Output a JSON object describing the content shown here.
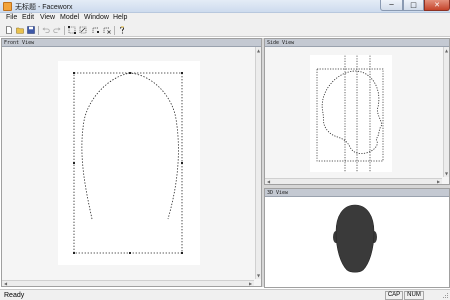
{
  "window": {
    "title": "无标题 - Faceworx",
    "minimize_glyph": "─",
    "maximize_glyph": "□",
    "close_glyph": "✕"
  },
  "menu": [
    "File",
    "Edit",
    "View",
    "Model",
    "Window",
    "Help"
  ],
  "toolbar": {
    "icons": [
      "new-file-icon",
      "open-folder-icon",
      "save-icon",
      "undo-icon",
      "redo-icon",
      "move-points-icon",
      "rotate-points-icon",
      "add-point-icon",
      "delete-point-icon",
      "help-icon"
    ]
  },
  "panes": {
    "front": {
      "title": "Front View"
    },
    "side": {
      "title": "Side View"
    },
    "view3d": {
      "title": "3D View"
    }
  },
  "status": {
    "text": "Ready",
    "caps": "CAP",
    "num": "NUM"
  },
  "colors": {
    "head_fill": "#3a3a3a",
    "pane_title_bg": "#c4c9d2"
  }
}
